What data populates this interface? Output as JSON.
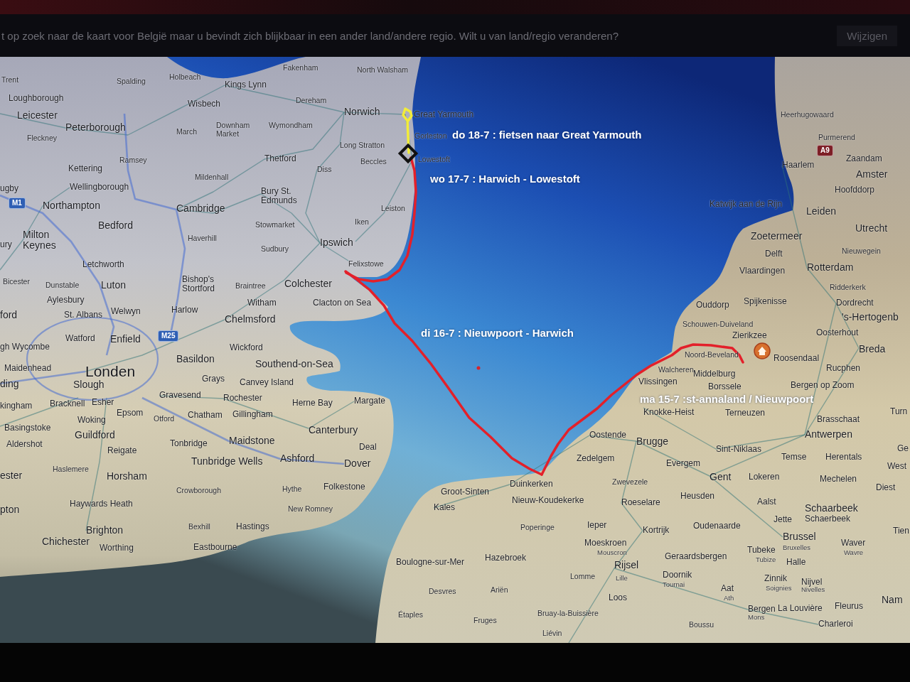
{
  "banner": {
    "message": "t op zoek naar de kaart voor België maar u bevindt zich blijkbaar in een ander land/andere regio. Wilt u van land/regio veranderen?",
    "button": "Wijzigen"
  },
  "map": {
    "legs": [
      {
        "note": "do 18-7 : fietsen naar Great Yarmouth",
        "color": "#f2ec3a"
      },
      {
        "note": "wo 17-7 : Harwich - Lowestoft",
        "color": "#e3202a"
      },
      {
        "note": "di 16-7 : Nieuwpoort - Harwich",
        "color": "#e3202a"
      },
      {
        "note": "ma 15-7 :st-annaland / Nieuwpoort",
        "color": "#e3202a"
      }
    ],
    "britain_labels": [
      {
        "text": "Fakenham",
        "kind": "village"
      },
      {
        "text": "North Walsham",
        "kind": "village"
      },
      {
        "text": "Trent",
        "kind": "village"
      },
      {
        "text": "Spalding",
        "kind": "village"
      },
      {
        "text": "Holbeach",
        "kind": "village"
      },
      {
        "text": "Kings Lynn",
        "kind": "town"
      },
      {
        "text": "Loughborough",
        "kind": "town"
      },
      {
        "text": "Wisbech",
        "kind": "town"
      },
      {
        "text": "Dereham",
        "kind": "village"
      },
      {
        "text": "Leicester",
        "kind": "city"
      },
      {
        "text": "Norwich",
        "kind": "city"
      },
      {
        "text": "Great Yarmouth",
        "kind": "town"
      },
      {
        "text": "Peterborough",
        "kind": "city"
      },
      {
        "text": "March",
        "kind": "village"
      },
      {
        "text": "Downham Market",
        "kind": "village"
      },
      {
        "text": "Wymondham",
        "kind": "village"
      },
      {
        "text": "Fleckney",
        "kind": "village"
      },
      {
        "text": "Gorleston",
        "kind": "village"
      },
      {
        "text": "Long Stratton",
        "kind": "village"
      },
      {
        "text": "Ramsey",
        "kind": "village"
      },
      {
        "text": "Thetford",
        "kind": "town"
      },
      {
        "text": "Beccles",
        "kind": "village"
      },
      {
        "text": "Lowestoft",
        "kind": "village"
      },
      {
        "text": "Kettering",
        "kind": "town"
      },
      {
        "text": "Mildenhall",
        "kind": "village"
      },
      {
        "text": "Diss",
        "kind": "village"
      },
      {
        "text": "ugby",
        "kind": "town"
      },
      {
        "text": "Wellingborough",
        "kind": "town"
      },
      {
        "text": "M1",
        "kind": "shield",
        "color": "#2f5fb4"
      },
      {
        "text": "Northampton",
        "kind": "city"
      },
      {
        "text": "Cambridge",
        "kind": "city"
      },
      {
        "text": "Bury St. Edmunds",
        "kind": "town"
      },
      {
        "text": "Leiston",
        "kind": "village"
      },
      {
        "text": "Milton Keynes",
        "kind": "city"
      },
      {
        "text": "Bedford",
        "kind": "city"
      },
      {
        "text": "Stowmarket",
        "kind": "village"
      },
      {
        "text": "Iken",
        "kind": "village"
      },
      {
        "text": "ury",
        "kind": "town"
      },
      {
        "text": "Haverhill",
        "kind": "village"
      },
      {
        "text": "Sudbury",
        "kind": "village"
      },
      {
        "text": "Ipswich",
        "kind": "city"
      },
      {
        "text": "Letchworth",
        "kind": "town"
      },
      {
        "text": "Felixstowe",
        "kind": "village"
      },
      {
        "text": "Bicester",
        "kind": "village"
      },
      {
        "text": "Dunstable",
        "kind": "village"
      },
      {
        "text": "Luton",
        "kind": "city"
      },
      {
        "text": "Bishop's Stortford",
        "kind": "town"
      },
      {
        "text": "Braintree",
        "kind": "village"
      },
      {
        "text": "Colchester",
        "kind": "city"
      },
      {
        "text": "Aylesbury",
        "kind": "town"
      },
      {
        "text": "Witham",
        "kind": "town"
      },
      {
        "text": "Clacton on Sea",
        "kind": "town"
      },
      {
        "text": "ford",
        "kind": "city"
      },
      {
        "text": "St. Albans",
        "kind": "town"
      },
      {
        "text": "Welwyn",
        "kind": "town"
      },
      {
        "text": "Harlow",
        "kind": "town"
      },
      {
        "text": "Chelmsford",
        "kind": "city"
      },
      {
        "text": "Watford",
        "kind": "town"
      },
      {
        "text": "Enfield",
        "kind": "city"
      },
      {
        "text": "M25",
        "kind": "shield",
        "color": "#2f5fb4"
      },
      {
        "text": "gh Wycombe",
        "kind": "town"
      },
      {
        "text": "Wickford",
        "kind": "town"
      },
      {
        "text": "Maidenhead",
        "kind": "town"
      },
      {
        "text": "Londen",
        "kind": "capital"
      },
      {
        "text": "Basildon",
        "kind": "city"
      },
      {
        "text": "Southend-on-Sea",
        "kind": "city"
      },
      {
        "text": "ding",
        "kind": "city"
      },
      {
        "text": "Slough",
        "kind": "city"
      },
      {
        "text": "Grays",
        "kind": "town"
      },
      {
        "text": "Canvey Island",
        "kind": "town"
      },
      {
        "text": "kingham",
        "kind": "town"
      },
      {
        "text": "Bracknell",
        "kind": "town"
      },
      {
        "text": "Esher",
        "kind": "town"
      },
      {
        "text": "Gravesend",
        "kind": "town"
      },
      {
        "text": "Rochester",
        "kind": "town"
      },
      {
        "text": "Herne Bay",
        "kind": "town"
      },
      {
        "text": "Margate",
        "kind": "town"
      },
      {
        "text": "Woking",
        "kind": "town"
      },
      {
        "text": "Epsom",
        "kind": "town"
      },
      {
        "text": "Otford",
        "kind": "village"
      },
      {
        "text": "Chatham",
        "kind": "town"
      },
      {
        "text": "Gillingham",
        "kind": "town"
      },
      {
        "text": "Basingstoke",
        "kind": "town"
      },
      {
        "text": "Aldershot",
        "kind": "town"
      },
      {
        "text": "Guildford",
        "kind": "city"
      },
      {
        "text": "Reigate",
        "kind": "town"
      },
      {
        "text": "Tonbridge",
        "kind": "town"
      },
      {
        "text": "Maidstone",
        "kind": "city"
      },
      {
        "text": "Canterbury",
        "kind": "city"
      },
      {
        "text": "Deal",
        "kind": "town"
      },
      {
        "text": "Tunbridge Wells",
        "kind": "city"
      },
      {
        "text": "Ashford",
        "kind": "city"
      },
      {
        "text": "Dover",
        "kind": "city"
      },
      {
        "text": "ester",
        "kind": "city"
      },
      {
        "text": "Haslemere",
        "kind": "village"
      },
      {
        "text": "Horsham",
        "kind": "city"
      },
      {
        "text": "Crowborough",
        "kind": "village"
      },
      {
        "text": "Hythe",
        "kind": "village"
      },
      {
        "text": "Folkestone",
        "kind": "town"
      },
      {
        "text": "pton",
        "kind": "city"
      },
      {
        "text": "Haywards Heath",
        "kind": "town"
      },
      {
        "text": "New Romney",
        "kind": "village"
      },
      {
        "text": "Brighton",
        "kind": "city"
      },
      {
        "text": "Bexhill",
        "kind": "village"
      },
      {
        "text": "Hastings",
        "kind": "town"
      },
      {
        "text": "Chichester",
        "kind": "city"
      },
      {
        "text": "Worthing",
        "kind": "town"
      },
      {
        "text": "Eastbourne",
        "kind": "town"
      }
    ],
    "mainland_labels": [
      {
        "text": "Heerhugowaard",
        "kind": "village"
      },
      {
        "text": "Purmerend",
        "kind": "village"
      },
      {
        "text": "A9",
        "kind": "shield",
        "color": "#7d1f26"
      },
      {
        "text": "Haarlem",
        "kind": "town"
      },
      {
        "text": "Zaandam",
        "kind": "town"
      },
      {
        "text": "Amster",
        "kind": "city"
      },
      {
        "text": "Hoofddorp",
        "kind": "town"
      },
      {
        "text": "Katwijk aan de Rijn",
        "kind": "town"
      },
      {
        "text": "Leiden",
        "kind": "city"
      },
      {
        "text": "Zoetermeer",
        "kind": "city"
      },
      {
        "text": "Utrecht",
        "kind": "city"
      },
      {
        "text": "Delft",
        "kind": "town"
      },
      {
        "text": "Nieuwegein",
        "kind": "village"
      },
      {
        "text": "Vlaardingen",
        "kind": "town"
      },
      {
        "text": "Rotterdam",
        "kind": "city"
      },
      {
        "text": "Ridderkerk",
        "kind": "village"
      },
      {
        "text": "Ouddorp",
        "kind": "town"
      },
      {
        "text": "Spijkenisse",
        "kind": "town"
      },
      {
        "text": "Dordrecht",
        "kind": "town"
      },
      {
        "text": "Schouwen-Duiveland",
        "kind": "village"
      },
      {
        "text": "'s-Hertogenb",
        "kind": "city"
      },
      {
        "text": "Zierikzee",
        "kind": "town"
      },
      {
        "text": "Oosterhout",
        "kind": "town"
      },
      {
        "text": "Noord-Beveland",
        "kind": "village"
      },
      {
        "text": "Roosendaal",
        "kind": "town"
      },
      {
        "text": "Breda",
        "kind": "city"
      },
      {
        "text": "Walcheren",
        "kind": "village"
      },
      {
        "text": "Middelburg",
        "kind": "town"
      },
      {
        "text": "Rucphen",
        "kind": "town"
      },
      {
        "text": "Vlissingen",
        "kind": "town"
      },
      {
        "text": "Borssele",
        "kind": "town"
      },
      {
        "text": "Bergen op Zoom",
        "kind": "town"
      },
      {
        "text": "Knokke-Heist",
        "kind": "town"
      },
      {
        "text": "Terneuzen",
        "kind": "town"
      },
      {
        "text": "Brasschaat",
        "kind": "town"
      },
      {
        "text": "Turn",
        "kind": "town"
      },
      {
        "text": "Oostende",
        "kind": "town"
      },
      {
        "text": "Brugge",
        "kind": "city"
      },
      {
        "text": "Antwerpen",
        "kind": "city"
      },
      {
        "text": "Sint-Niklaas",
        "kind": "town"
      },
      {
        "text": "Ge",
        "kind": "town"
      },
      {
        "text": "Zedelgem",
        "kind": "town"
      },
      {
        "text": "Evergem",
        "kind": "town"
      },
      {
        "text": "Temse",
        "kind": "town"
      },
      {
        "text": "Herentals",
        "kind": "town"
      },
      {
        "text": "West",
        "kind": "town"
      },
      {
        "text": "Groot-Sinten",
        "kind": "town"
      },
      {
        "text": "Duinkerken",
        "kind": "town"
      },
      {
        "text": "Zwevezele",
        "kind": "village"
      },
      {
        "text": "Gent",
        "kind": "city"
      },
      {
        "text": "Lokeren",
        "kind": "town"
      },
      {
        "text": "Mechelen",
        "kind": "town"
      },
      {
        "text": "Diest",
        "kind": "town"
      },
      {
        "text": "Kales",
        "kind": "town"
      },
      {
        "text": "Nieuw-Koudekerke",
        "kind": "town"
      },
      {
        "text": "Roeselare",
        "kind": "town"
      },
      {
        "text": "Heusden",
        "kind": "town"
      },
      {
        "text": "Aalst",
        "kind": "town"
      },
      {
        "text": "Schaarbeek",
        "kind": "city"
      },
      {
        "text": "Jette",
        "kind": "town"
      },
      {
        "text": "Schaerbeek",
        "kind": "town"
      },
      {
        "text": "Poperinge",
        "kind": "village"
      },
      {
        "text": "Ieper",
        "kind": "town"
      },
      {
        "text": "Kortrijk",
        "kind": "town"
      },
      {
        "text": "Oudenaarde",
        "kind": "town"
      },
      {
        "text": "Brussel",
        "kind": "city"
      },
      {
        "text": "Tien",
        "kind": "town"
      },
      {
        "text": "Moeskroen",
        "kind": "town"
      },
      {
        "text": "Waver",
        "kind": "town"
      },
      {
        "text": "Mouscron",
        "kind": "alt"
      },
      {
        "text": "Tubeke",
        "kind": "town"
      },
      {
        "text": "Bruxelles",
        "kind": "alt"
      },
      {
        "text": "Wavre",
        "kind": "alt"
      },
      {
        "text": "Boulogne-sur-Mer",
        "kind": "town"
      },
      {
        "text": "Hazebroek",
        "kind": "town"
      },
      {
        "text": "Rijsel",
        "kind": "city"
      },
      {
        "text": "Geraardsbergen",
        "kind": "town"
      },
      {
        "text": "Tubize",
        "kind": "alt"
      },
      {
        "text": "Halle",
        "kind": "town"
      },
      {
        "text": "Lomme",
        "kind": "village"
      },
      {
        "text": "Lille",
        "kind": "alt"
      },
      {
        "text": "Doornik",
        "kind": "town"
      },
      {
        "text": "Zinnik",
        "kind": "town"
      },
      {
        "text": "Nijvel",
        "kind": "town"
      },
      {
        "text": "Desvres",
        "kind": "village"
      },
      {
        "text": "Ariën",
        "kind": "village"
      },
      {
        "text": "Tournai",
        "kind": "alt"
      },
      {
        "text": "Aat",
        "kind": "town"
      },
      {
        "text": "Soignies",
        "kind": "alt"
      },
      {
        "text": "Nivelles",
        "kind": "alt"
      },
      {
        "text": "Loos",
        "kind": "town"
      },
      {
        "text": "Ath",
        "kind": "alt"
      },
      {
        "text": "Bergen",
        "kind": "town"
      },
      {
        "text": "La Louvière",
        "kind": "town"
      },
      {
        "text": "Fleurus",
        "kind": "town"
      },
      {
        "text": "Nam",
        "kind": "city"
      },
      {
        "text": "Étaples",
        "kind": "village"
      },
      {
        "text": "Fruges",
        "kind": "village"
      },
      {
        "text": "Bruay-la-Buissière",
        "kind": "village"
      },
      {
        "text": "Mons",
        "kind": "alt"
      },
      {
        "text": "Boussu",
        "kind": "village"
      },
      {
        "text": "Charleroi",
        "kind": "town"
      },
      {
        "text": "Liévin",
        "kind": "village"
      }
    ]
  }
}
